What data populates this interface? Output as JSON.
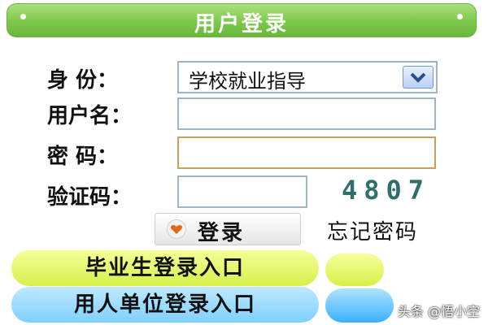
{
  "header": {
    "title": "用户登录"
  },
  "form": {
    "identity_label": "身   份：",
    "identity_value": "学校就业指导",
    "username_label": "用户名：",
    "username_value": "",
    "password_label": "密   码：",
    "password_value": "",
    "captcha_label": "验证码：",
    "captcha_value": "",
    "captcha_code": "4807"
  },
  "actions": {
    "login_label": "登录",
    "forgot_label": "忘记密码"
  },
  "entries": {
    "graduate_label": "毕业生登录入口",
    "employer_label": "用人单位登录入口"
  },
  "watermark": "头条 @悟小空"
}
